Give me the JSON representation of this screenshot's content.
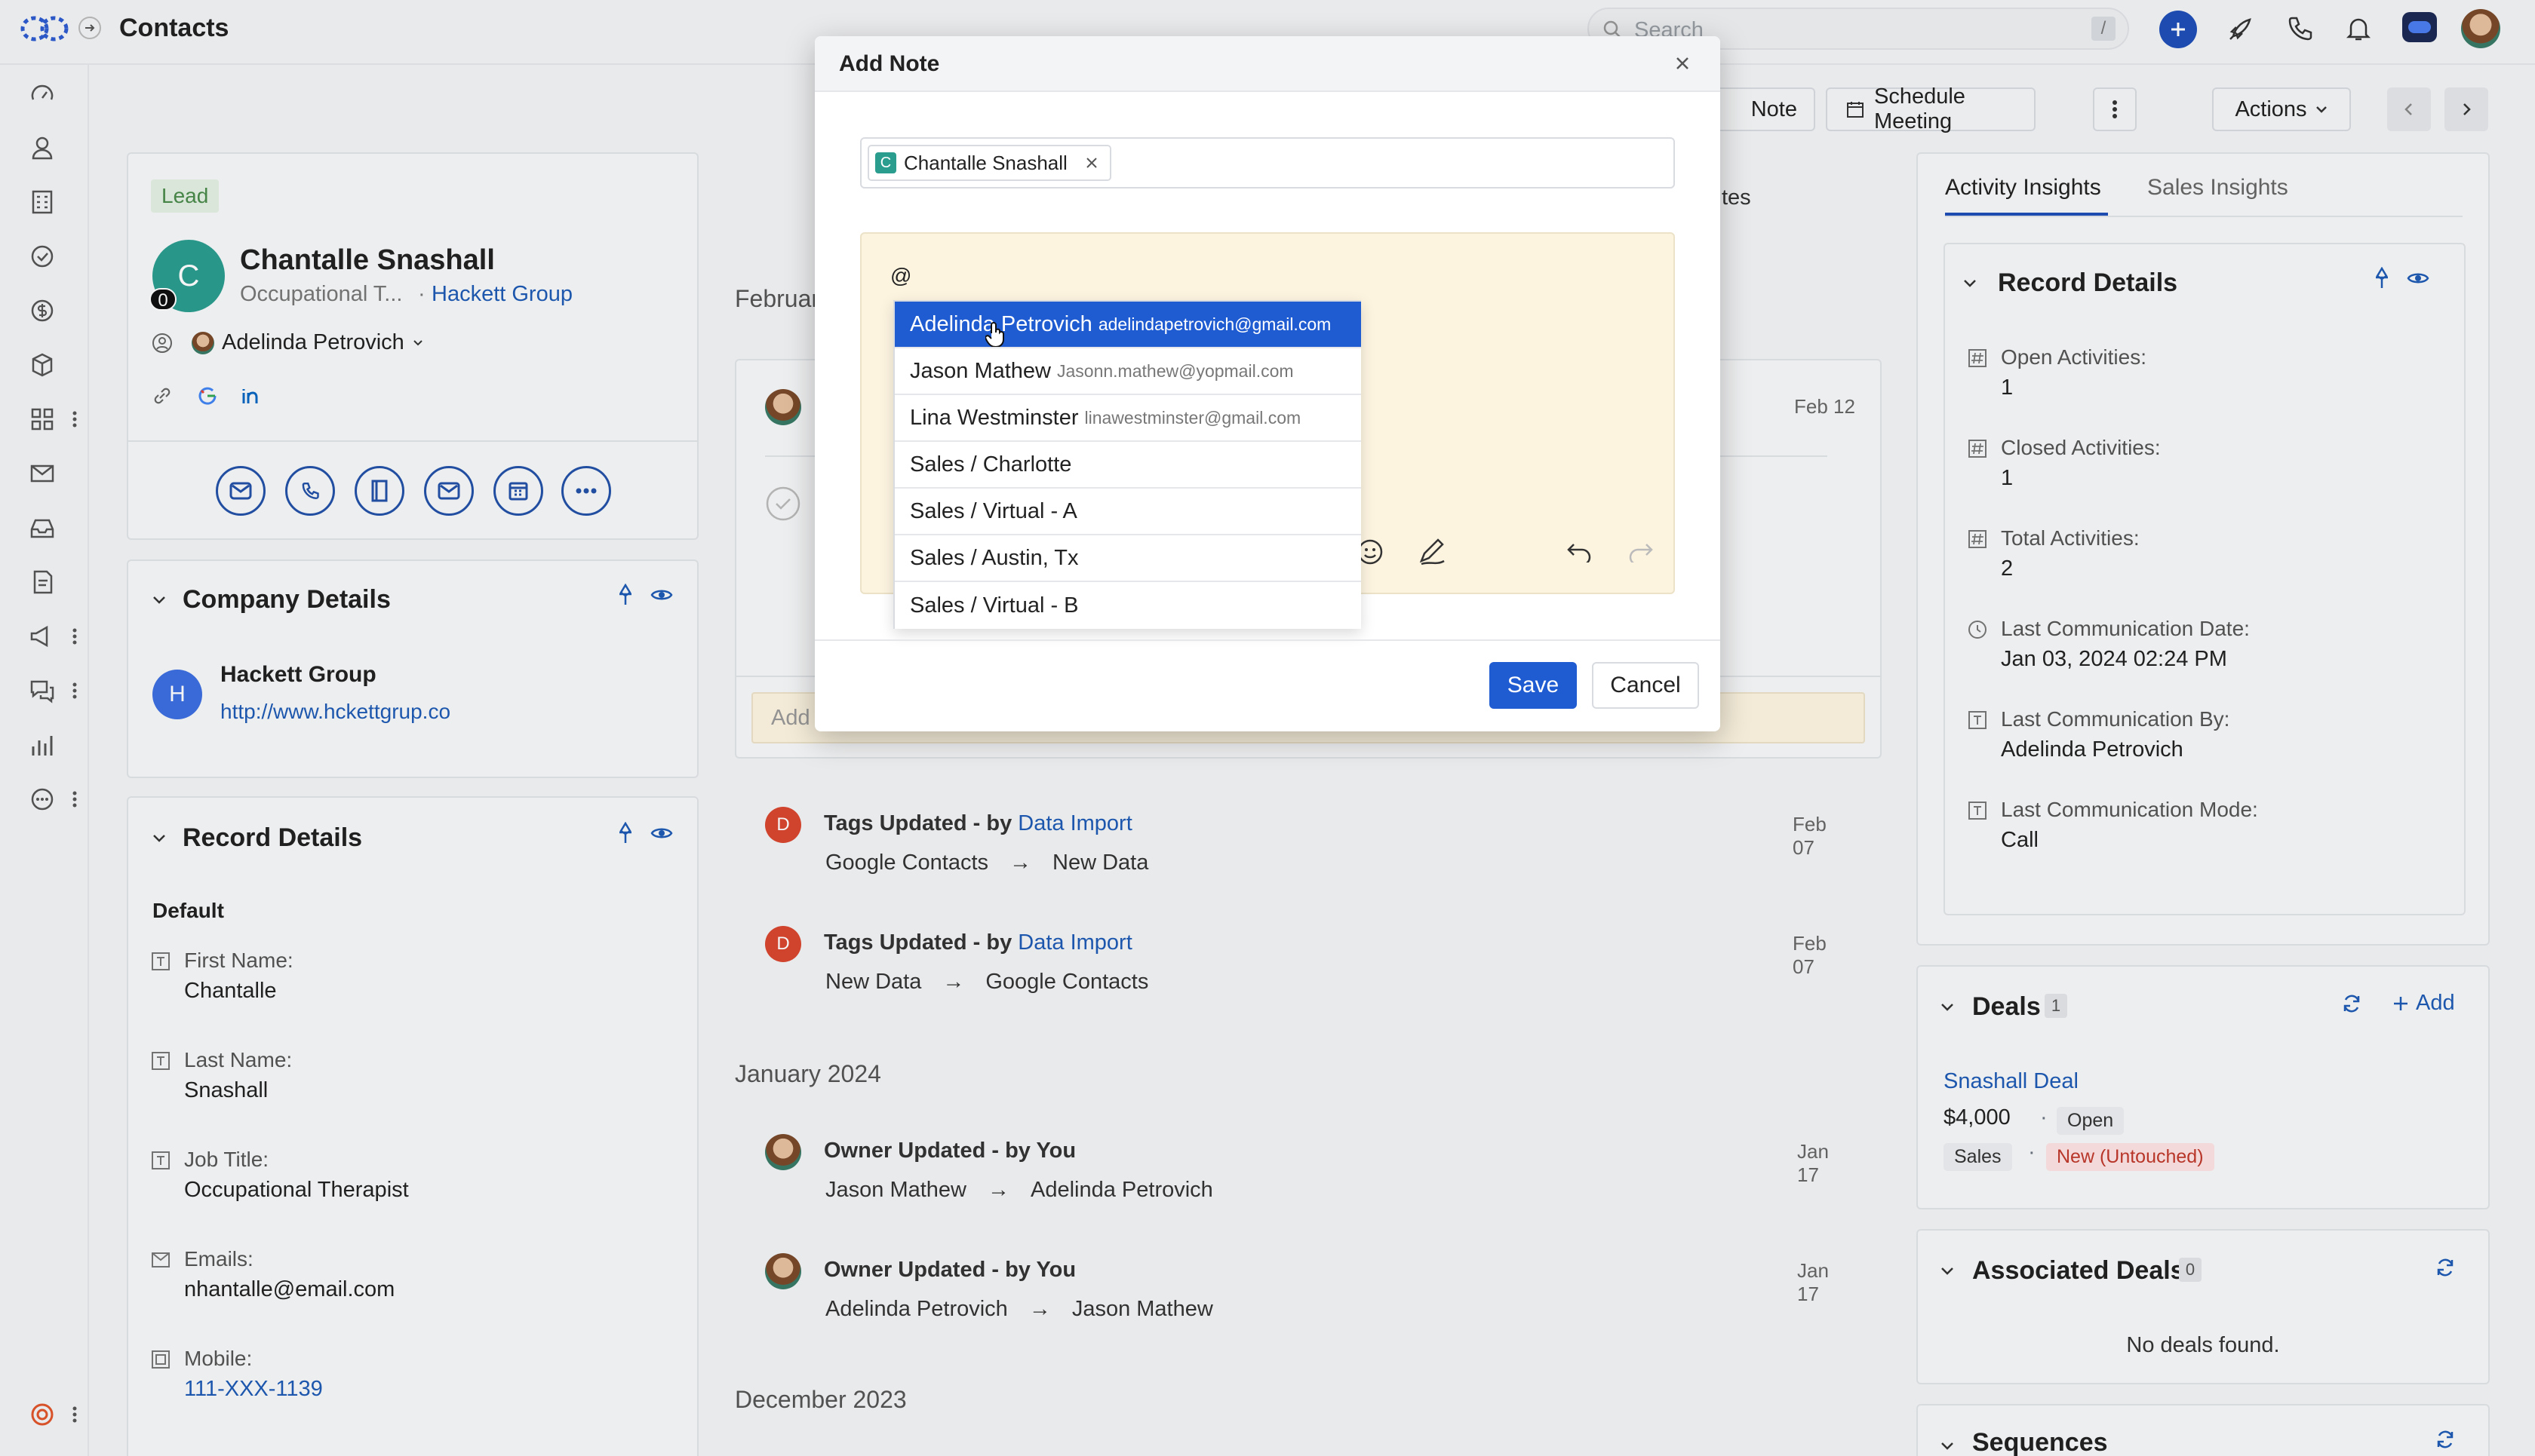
{
  "app": {
    "page_title": "Contacts"
  },
  "search": {
    "placeholder": "Search",
    "shortcut": "/"
  },
  "colors": {
    "accent": "#1f5bd1",
    "link": "#1f5bb5",
    "lead_badge_bg": "#e2f0e2",
    "lead_badge_text": "#4a8a4a",
    "avatar_teal": "#2a9d8f",
    "danger_tag_bg": "#fde2e2",
    "danger_tag_text": "#c0392b"
  },
  "header_actions": {
    "note": "Note",
    "schedule_meeting": "Schedule Meeting",
    "actions": "Actions"
  },
  "profile": {
    "badge": "Lead",
    "avatar_letter": "C",
    "avatar_count": "0",
    "name": "Chantalle Snashall",
    "job_short": "Occupational T...",
    "company_sep": "·",
    "company": "Hackett Group",
    "owner": "Adelinda Petrovich"
  },
  "company_details": {
    "title": "Company Details",
    "avatar_letter": "H",
    "name": "Hackett Group",
    "url": "http://www.hckettgrup.co"
  },
  "record_details_left": {
    "title": "Record Details",
    "section": "Default",
    "fields": [
      {
        "label": "First Name:",
        "value": "Chantalle"
      },
      {
        "label": "Last Name:",
        "value": "Snashall"
      },
      {
        "label": "Job Title:",
        "value": "Occupational Therapist"
      },
      {
        "label": "Emails:",
        "value": "nhantalle@email.com"
      },
      {
        "label": "Mobile:",
        "value": "111-XXX-1139"
      }
    ]
  },
  "timeline": {
    "feb_partial": "Februar",
    "tes_partial": "tes",
    "feb12": "Feb 12",
    "add_placeholder_partial": "Add",
    "entries": [
      {
        "title": "Tags Updated",
        "by": " - by ",
        "actor": "Data Import",
        "date": "Feb 07",
        "from": "Google Contacts",
        "to": "New Data",
        "avatar": "D"
      },
      {
        "title": "Tags Updated",
        "by": " - by ",
        "actor": "Data Import",
        "date": "Feb 07",
        "from": "New Data",
        "to": "Google Contacts",
        "avatar": "D"
      }
    ],
    "jan_header": "January 2024",
    "jan_entries": [
      {
        "title": "Owner Updated",
        "by": " - by You",
        "date": "Jan 17",
        "from": "Jason Mathew",
        "to": "Adelinda Petrovich"
      },
      {
        "title": "Owner Updated",
        "by": " - by You",
        "date": "Jan 17",
        "from": "Adelinda Petrovich",
        "to": "Jason Mathew"
      }
    ],
    "dec_header": "December 2023",
    "arrow": "→"
  },
  "right_panel": {
    "tabs": [
      "Activity Insights",
      "Sales Insights"
    ],
    "record_details": {
      "title": "Record Details",
      "fields": [
        {
          "label": "Open Activities:",
          "value": "1"
        },
        {
          "label": "Closed Activities:",
          "value": "1"
        },
        {
          "label": "Total Activities:",
          "value": "2"
        },
        {
          "label": "Last Communication Date:",
          "value": "Jan 03, 2024 02:24 PM"
        },
        {
          "label": "Last Communication By:",
          "value": "Adelinda Petrovich"
        },
        {
          "label": "Last Communication Mode:",
          "value": "Call"
        }
      ]
    },
    "deals": {
      "title": "Deals",
      "count": "1",
      "add": "Add",
      "deal_name": "Snashall Deal",
      "amount": "$4,000",
      "dot": "·",
      "status": "Open",
      "pipeline": "Sales",
      "stage": "New (Untouched)"
    },
    "associated_deals": {
      "title": "Associated Deals",
      "count": "0",
      "empty": "No deals found."
    },
    "sequences": {
      "title": "Sequences"
    }
  },
  "modal": {
    "title": "Add Note",
    "chip_letter": "C",
    "chip_label": "Chantalle Snashall",
    "editor_text": "@",
    "mentions": [
      {
        "name": "Adelinda Petrovich",
        "email": "adelindapetrovich@gmail.com"
      },
      {
        "name": "Jason Mathew",
        "email": "Jasonn.mathew@yopmail.com"
      },
      {
        "name": "Lina Westminster",
        "email": "linawestminster@gmail.com"
      },
      {
        "name": "Sales / Charlotte",
        "email": ""
      },
      {
        "name": "Sales / Virtual - A",
        "email": ""
      },
      {
        "name": "Sales / Austin, Tx",
        "email": ""
      },
      {
        "name": "Sales / Virtual - B",
        "email": ""
      }
    ],
    "save": "Save",
    "cancel": "Cancel"
  }
}
